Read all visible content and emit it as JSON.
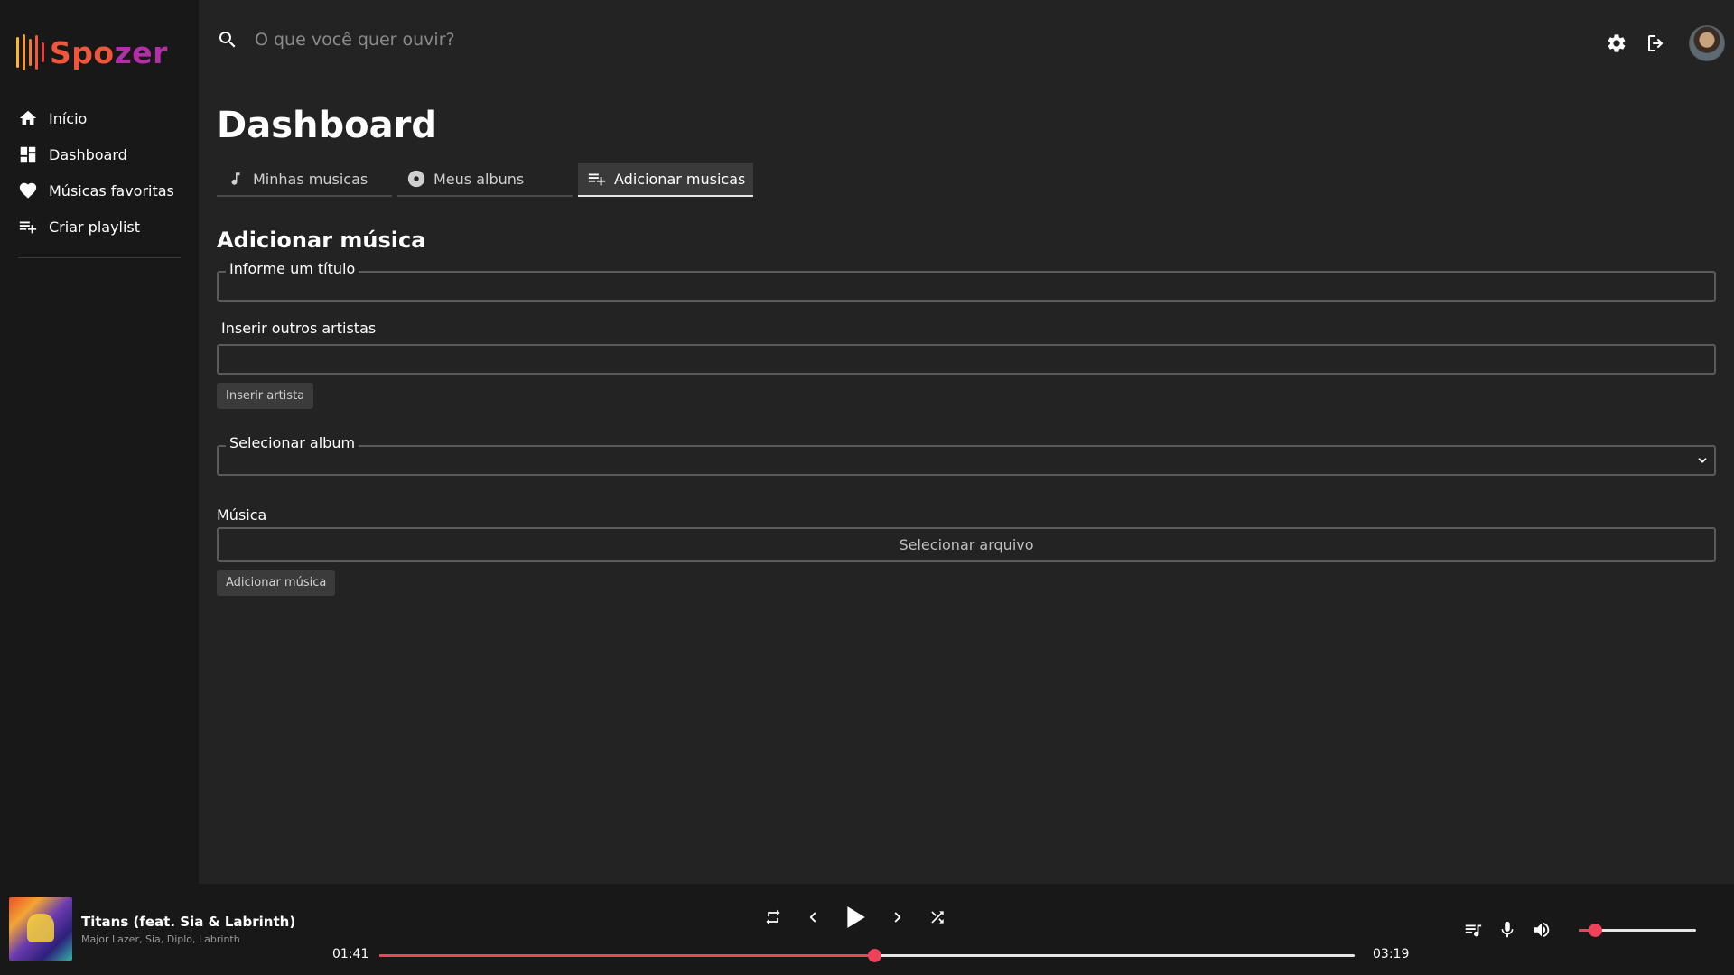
{
  "app": {
    "logo_text_a": "Spo",
    "logo_text_b": "zer",
    "logo_icon": "sound-bars-icon",
    "accent": "#f0415a"
  },
  "sidebar": {
    "items": [
      {
        "label": "Início",
        "icon": "home-icon"
      },
      {
        "label": "Dashboard",
        "icon": "dashboard-icon"
      },
      {
        "label": "Músicas favoritas",
        "icon": "heart-icon"
      },
      {
        "label": "Criar playlist",
        "icon": "playlist-add-icon"
      }
    ]
  },
  "topbar": {
    "search_placeholder": "O que você quer ouvir?",
    "icons": [
      "settings-icon",
      "logout-icon",
      "avatar"
    ]
  },
  "main": {
    "title": "Dashboard",
    "tabs": [
      {
        "label": "Minhas musicas",
        "icon": "music-note-icon",
        "active": false
      },
      {
        "label": "Meus albuns",
        "icon": "album-icon",
        "active": false
      },
      {
        "label": "Adicionar musicas",
        "icon": "playlist-add-icon",
        "active": true
      }
    ],
    "form": {
      "title": "Adicionar música",
      "title_field_label": "Informe um título",
      "title_field_value": "",
      "artists_label": "Inserir outros artistas",
      "artists_value": "",
      "insert_artist_button": "Inserir artista",
      "album_label": "Selecionar album",
      "album_value": "",
      "file_label": "Música",
      "file_button": "Selecionar arquivo",
      "submit_button": "Adicionar música"
    }
  },
  "player": {
    "track_title": "Titans (feat. Sia & Labrinth)",
    "track_artists": "Major Lazer, Sia, Diplo, Labrinth",
    "time_current": "01:41",
    "time_total": "03:19",
    "progress_fraction": 0.507,
    "volume_fraction": 0.14,
    "controls": [
      "repeat-icon",
      "previous-icon",
      "play-icon",
      "next-icon",
      "shuffle-icon"
    ],
    "right_controls": [
      "queue-icon",
      "lyrics-mic-icon",
      "volume-icon"
    ]
  }
}
